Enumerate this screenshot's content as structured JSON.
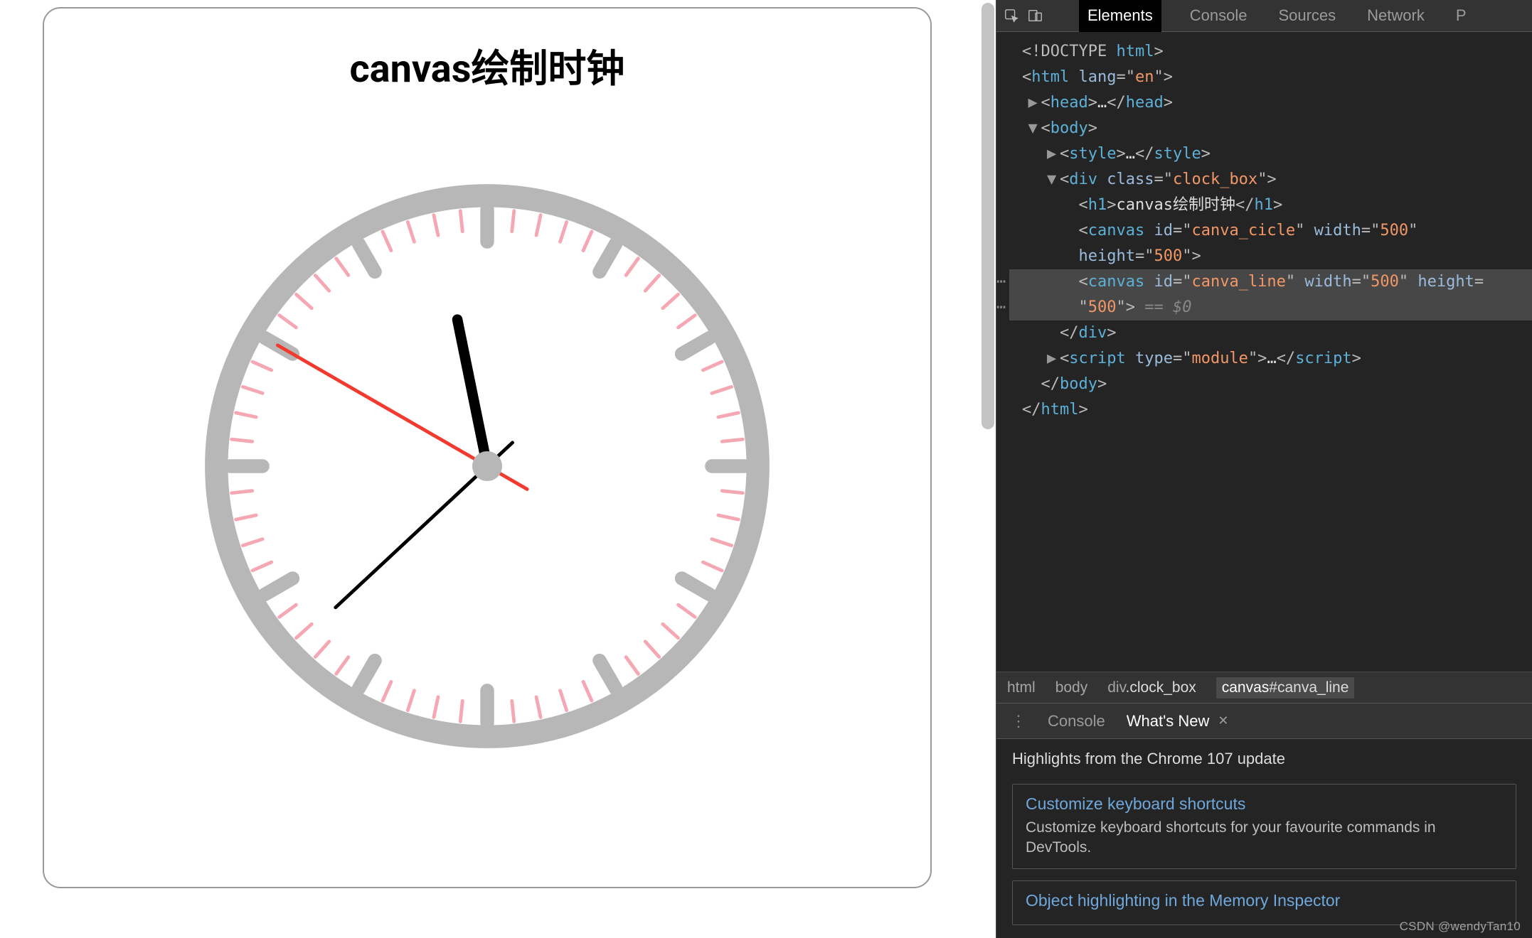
{
  "page": {
    "title": "canvas绘制时钟"
  },
  "clock": {
    "radius_outer": 250,
    "color_ring": "#b7b7b7",
    "color_minute_tick": "#f5a7b3",
    "color_hour_tick": "#b7b7b7",
    "color_hour_hand": "#000000",
    "color_minute_hand": "#000000",
    "color_second_hand": "#f23a2f",
    "time_approx": "11:37:50"
  },
  "devtools": {
    "tabs": [
      "Elements",
      "Console",
      "Sources",
      "Network",
      "P"
    ],
    "active_tab": "Elements",
    "dom_lines": [
      {
        "indent": 0,
        "arrow": "",
        "html": "<span class='punct'>&lt;!DOCTYPE </span><span class='tag'>html</span><span class='punct'>&gt;</span>"
      },
      {
        "indent": 0,
        "arrow": "",
        "html": "<span class='punct'>&lt;</span><span class='tag'>html</span> <span class='attr-name'>lang</span><span class='punct'>=\"</span><span class='attr-val'>en</span><span class='punct'>\"&gt;</span>"
      },
      {
        "indent": 1,
        "arrow": "▶",
        "html": "<span class='punct'>&lt;</span><span class='tag'>head</span><span class='punct'>&gt;</span><span class='text-node'>…</span><span class='punct'>&lt;/</span><span class='tag'>head</span><span class='punct'>&gt;</span>"
      },
      {
        "indent": 1,
        "arrow": "▼",
        "html": "<span class='punct'>&lt;</span><span class='tag'>body</span><span class='punct'>&gt;</span>"
      },
      {
        "indent": 2,
        "arrow": "▶",
        "html": "<span class='punct'>&lt;</span><span class='tag'>style</span><span class='punct'>&gt;</span><span class='text-node'>…</span><span class='punct'>&lt;/</span><span class='tag'>style</span><span class='punct'>&gt;</span>"
      },
      {
        "indent": 2,
        "arrow": "▼",
        "html": "<span class='punct'>&lt;</span><span class='tag'>div</span> <span class='attr-name'>class</span><span class='punct'>=\"</span><span class='attr-val'>clock_box</span><span class='punct'>\"&gt;</span>"
      },
      {
        "indent": 3,
        "arrow": "",
        "html": "<span class='punct'>&lt;</span><span class='tag'>h1</span><span class='punct'>&gt;</span><span class='text-node'>canvas绘制时钟</span><span class='punct'>&lt;/</span><span class='tag'>h1</span><span class='punct'>&gt;</span>"
      },
      {
        "indent": 3,
        "arrow": "",
        "html": "<span class='punct'>&lt;</span><span class='tag'>canvas</span> <span class='attr-name'>id</span><span class='punct'>=\"</span><span class='attr-val'>canva_cicle</span><span class='punct'>\"</span> <span class='attr-name'>width</span><span class='punct'>=\"</span><span class='attr-val'>500</span><span class='punct'>\"</span>"
      },
      {
        "indent": 3,
        "arrow": "",
        "cont": true,
        "html": "<span class='attr-name'>height</span><span class='punct'>=\"</span><span class='attr-val'>500</span><span class='punct'>\"&gt;</span>"
      },
      {
        "indent": 3,
        "arrow": "",
        "selected": true,
        "html": "<span class='punct'>&lt;</span><span class='tag'>canvas</span> <span class='attr-name'>id</span><span class='punct'>=\"</span><span class='attr-val'>canva_line</span><span class='punct'>\"</span> <span class='attr-name'>width</span><span class='punct'>=\"</span><span class='attr-val'>500</span><span class='punct'>\"</span> <span class='attr-name'>height</span><span class='punct'>=</span>"
      },
      {
        "indent": 3,
        "arrow": "",
        "selected": true,
        "cont": true,
        "html": "<span class='punct'>\"</span><span class='attr-val'>500</span><span class='punct'>\"&gt;</span> <span class='comment'>== $0</span>"
      },
      {
        "indent": 2,
        "arrow": "",
        "html": "<span class='punct'>&lt;/</span><span class='tag'>div</span><span class='punct'>&gt;</span>"
      },
      {
        "indent": 2,
        "arrow": "▶",
        "html": "<span class='punct'>&lt;</span><span class='tag'>script</span> <span class='attr-name'>type</span><span class='punct'>=\"</span><span class='attr-val'>module</span><span class='punct'>\"&gt;</span><span class='text-node'>…</span><span class='punct'>&lt;/</span><span class='tag'>script</span><span class='punct'>&gt;</span>"
      },
      {
        "indent": 1,
        "arrow": "",
        "html": "<span class='punct'>&lt;/</span><span class='tag'>body</span><span class='punct'>&gt;</span>"
      },
      {
        "indent": 0,
        "arrow": "",
        "html": "<span class='punct'>&lt;/</span><span class='tag'>html</span><span class='punct'>&gt;</span>"
      }
    ],
    "breadcrumb": [
      "html",
      "body",
      "div.clock_box",
      "canvas#canva_line"
    ],
    "active_crumb": "canvas#canva_line",
    "drawer": {
      "tabs": [
        "Console",
        "What's New"
      ],
      "active": "What's New",
      "headline": "Highlights from the Chrome 107 update",
      "cards": [
        {
          "title": "Customize keyboard shortcuts",
          "desc": "Customize keyboard shortcuts for your favourite commands in DevTools."
        },
        {
          "title": "Object highlighting in the Memory Inspector",
          "desc": ""
        }
      ]
    }
  },
  "watermark": "CSDN @wendyTan10"
}
